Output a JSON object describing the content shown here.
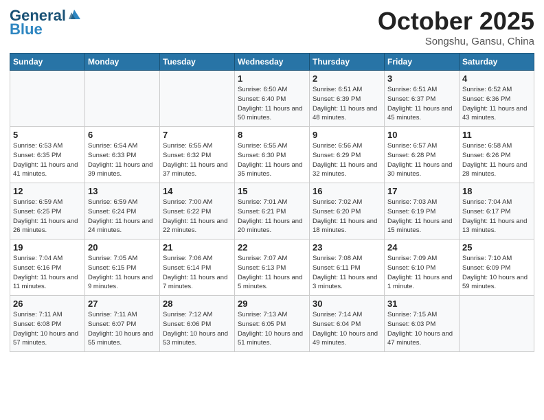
{
  "header": {
    "logo_line1a": "General",
    "logo_line1b": "Blue",
    "month": "October 2025",
    "location": "Songshu, Gansu, China"
  },
  "weekdays": [
    "Sunday",
    "Monday",
    "Tuesday",
    "Wednesday",
    "Thursday",
    "Friday",
    "Saturday"
  ],
  "weeks": [
    [
      {
        "day": "",
        "info": ""
      },
      {
        "day": "",
        "info": ""
      },
      {
        "day": "",
        "info": ""
      },
      {
        "day": "1",
        "info": "Sunrise: 6:50 AM\nSunset: 6:40 PM\nDaylight: 11 hours\nand 50 minutes."
      },
      {
        "day": "2",
        "info": "Sunrise: 6:51 AM\nSunset: 6:39 PM\nDaylight: 11 hours\nand 48 minutes."
      },
      {
        "day": "3",
        "info": "Sunrise: 6:51 AM\nSunset: 6:37 PM\nDaylight: 11 hours\nand 45 minutes."
      },
      {
        "day": "4",
        "info": "Sunrise: 6:52 AM\nSunset: 6:36 PM\nDaylight: 11 hours\nand 43 minutes."
      }
    ],
    [
      {
        "day": "5",
        "info": "Sunrise: 6:53 AM\nSunset: 6:35 PM\nDaylight: 11 hours\nand 41 minutes."
      },
      {
        "day": "6",
        "info": "Sunrise: 6:54 AM\nSunset: 6:33 PM\nDaylight: 11 hours\nand 39 minutes."
      },
      {
        "day": "7",
        "info": "Sunrise: 6:55 AM\nSunset: 6:32 PM\nDaylight: 11 hours\nand 37 minutes."
      },
      {
        "day": "8",
        "info": "Sunrise: 6:55 AM\nSunset: 6:30 PM\nDaylight: 11 hours\nand 35 minutes."
      },
      {
        "day": "9",
        "info": "Sunrise: 6:56 AM\nSunset: 6:29 PM\nDaylight: 11 hours\nand 32 minutes."
      },
      {
        "day": "10",
        "info": "Sunrise: 6:57 AM\nSunset: 6:28 PM\nDaylight: 11 hours\nand 30 minutes."
      },
      {
        "day": "11",
        "info": "Sunrise: 6:58 AM\nSunset: 6:26 PM\nDaylight: 11 hours\nand 28 minutes."
      }
    ],
    [
      {
        "day": "12",
        "info": "Sunrise: 6:59 AM\nSunset: 6:25 PM\nDaylight: 11 hours\nand 26 minutes."
      },
      {
        "day": "13",
        "info": "Sunrise: 6:59 AM\nSunset: 6:24 PM\nDaylight: 11 hours\nand 24 minutes."
      },
      {
        "day": "14",
        "info": "Sunrise: 7:00 AM\nSunset: 6:22 PM\nDaylight: 11 hours\nand 22 minutes."
      },
      {
        "day": "15",
        "info": "Sunrise: 7:01 AM\nSunset: 6:21 PM\nDaylight: 11 hours\nand 20 minutes."
      },
      {
        "day": "16",
        "info": "Sunrise: 7:02 AM\nSunset: 6:20 PM\nDaylight: 11 hours\nand 18 minutes."
      },
      {
        "day": "17",
        "info": "Sunrise: 7:03 AM\nSunset: 6:19 PM\nDaylight: 11 hours\nand 15 minutes."
      },
      {
        "day": "18",
        "info": "Sunrise: 7:04 AM\nSunset: 6:17 PM\nDaylight: 11 hours\nand 13 minutes."
      }
    ],
    [
      {
        "day": "19",
        "info": "Sunrise: 7:04 AM\nSunset: 6:16 PM\nDaylight: 11 hours\nand 11 minutes."
      },
      {
        "day": "20",
        "info": "Sunrise: 7:05 AM\nSunset: 6:15 PM\nDaylight: 11 hours\nand 9 minutes."
      },
      {
        "day": "21",
        "info": "Sunrise: 7:06 AM\nSunset: 6:14 PM\nDaylight: 11 hours\nand 7 minutes."
      },
      {
        "day": "22",
        "info": "Sunrise: 7:07 AM\nSunset: 6:13 PM\nDaylight: 11 hours\nand 5 minutes."
      },
      {
        "day": "23",
        "info": "Sunrise: 7:08 AM\nSunset: 6:11 PM\nDaylight: 11 hours\nand 3 minutes."
      },
      {
        "day": "24",
        "info": "Sunrise: 7:09 AM\nSunset: 6:10 PM\nDaylight: 11 hours\nand 1 minute."
      },
      {
        "day": "25",
        "info": "Sunrise: 7:10 AM\nSunset: 6:09 PM\nDaylight: 10 hours\nand 59 minutes."
      }
    ],
    [
      {
        "day": "26",
        "info": "Sunrise: 7:11 AM\nSunset: 6:08 PM\nDaylight: 10 hours\nand 57 minutes."
      },
      {
        "day": "27",
        "info": "Sunrise: 7:11 AM\nSunset: 6:07 PM\nDaylight: 10 hours\nand 55 minutes."
      },
      {
        "day": "28",
        "info": "Sunrise: 7:12 AM\nSunset: 6:06 PM\nDaylight: 10 hours\nand 53 minutes."
      },
      {
        "day": "29",
        "info": "Sunrise: 7:13 AM\nSunset: 6:05 PM\nDaylight: 10 hours\nand 51 minutes."
      },
      {
        "day": "30",
        "info": "Sunrise: 7:14 AM\nSunset: 6:04 PM\nDaylight: 10 hours\nand 49 minutes."
      },
      {
        "day": "31",
        "info": "Sunrise: 7:15 AM\nSunset: 6:03 PM\nDaylight: 10 hours\nand 47 minutes."
      },
      {
        "day": "",
        "info": ""
      }
    ]
  ]
}
